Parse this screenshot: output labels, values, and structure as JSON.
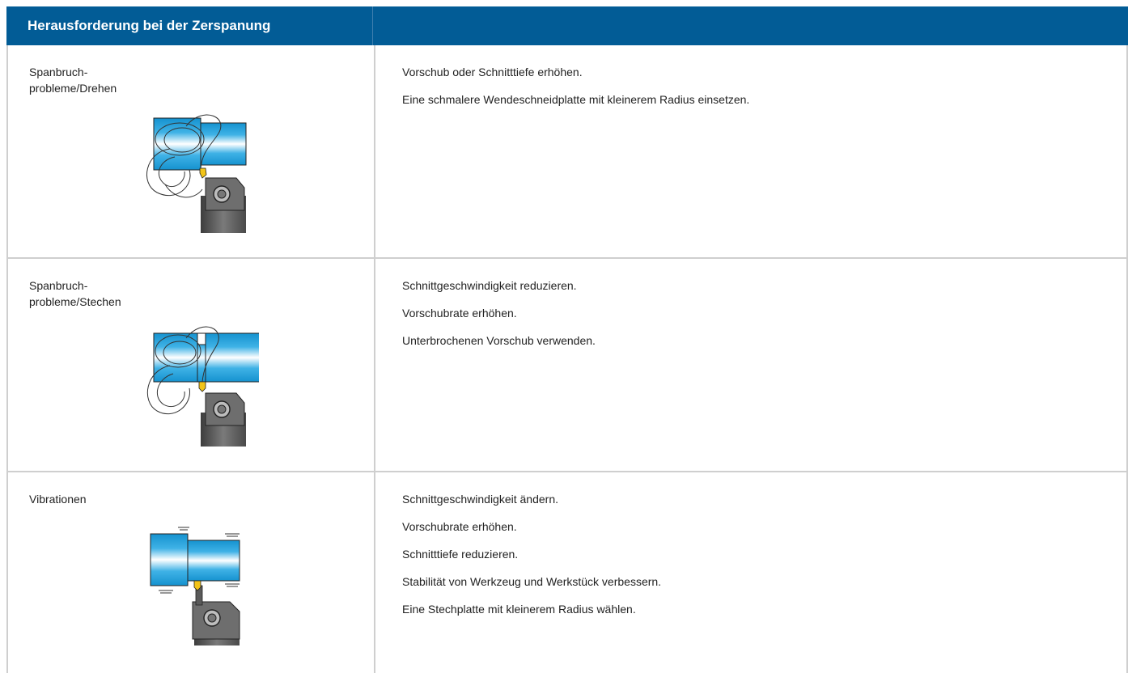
{
  "header": {
    "title": "Herausforderung bei der Zerspanung"
  },
  "rows": [
    {
      "challenge": "Spanbruch-\nprobleme/Drehen",
      "illustration_icon": "turning-chip-breaking-icon",
      "actions": [
        "Vorschub oder Schnitttiefe erhöhen.",
        "Eine schmalere Wendeschneidplatte mit kleinerem Radius einsetzen."
      ]
    },
    {
      "challenge": "Spanbruch-\nprobleme/Stechen",
      "illustration_icon": "grooving-chip-breaking-icon",
      "actions": [
        "Schnittgeschwindigkeit reduzieren.",
        "Vorschubrate erhöhen.",
        "Unterbrochenen Vorschub verwenden."
      ]
    },
    {
      "challenge": "Vibrationen",
      "illustration_icon": "vibration-icon",
      "actions": [
        "Schnittgeschwindigkeit ändern.",
        "Vorschubrate erhöhen.",
        "Schnitttiefe reduzieren.",
        "Stabilität von Werkzeug und Werkstück verbessern.",
        "Eine Stechplatte mit kleinerem Radius wählen."
      ]
    }
  ],
  "colors": {
    "header_bg": "#025c96",
    "header_text": "#ffffff",
    "border": "#cfcfcf",
    "workpiece_blue": "#1a9ad6",
    "insert_yellow": "#f2c418",
    "holder_gray": "#6e6e6e"
  }
}
